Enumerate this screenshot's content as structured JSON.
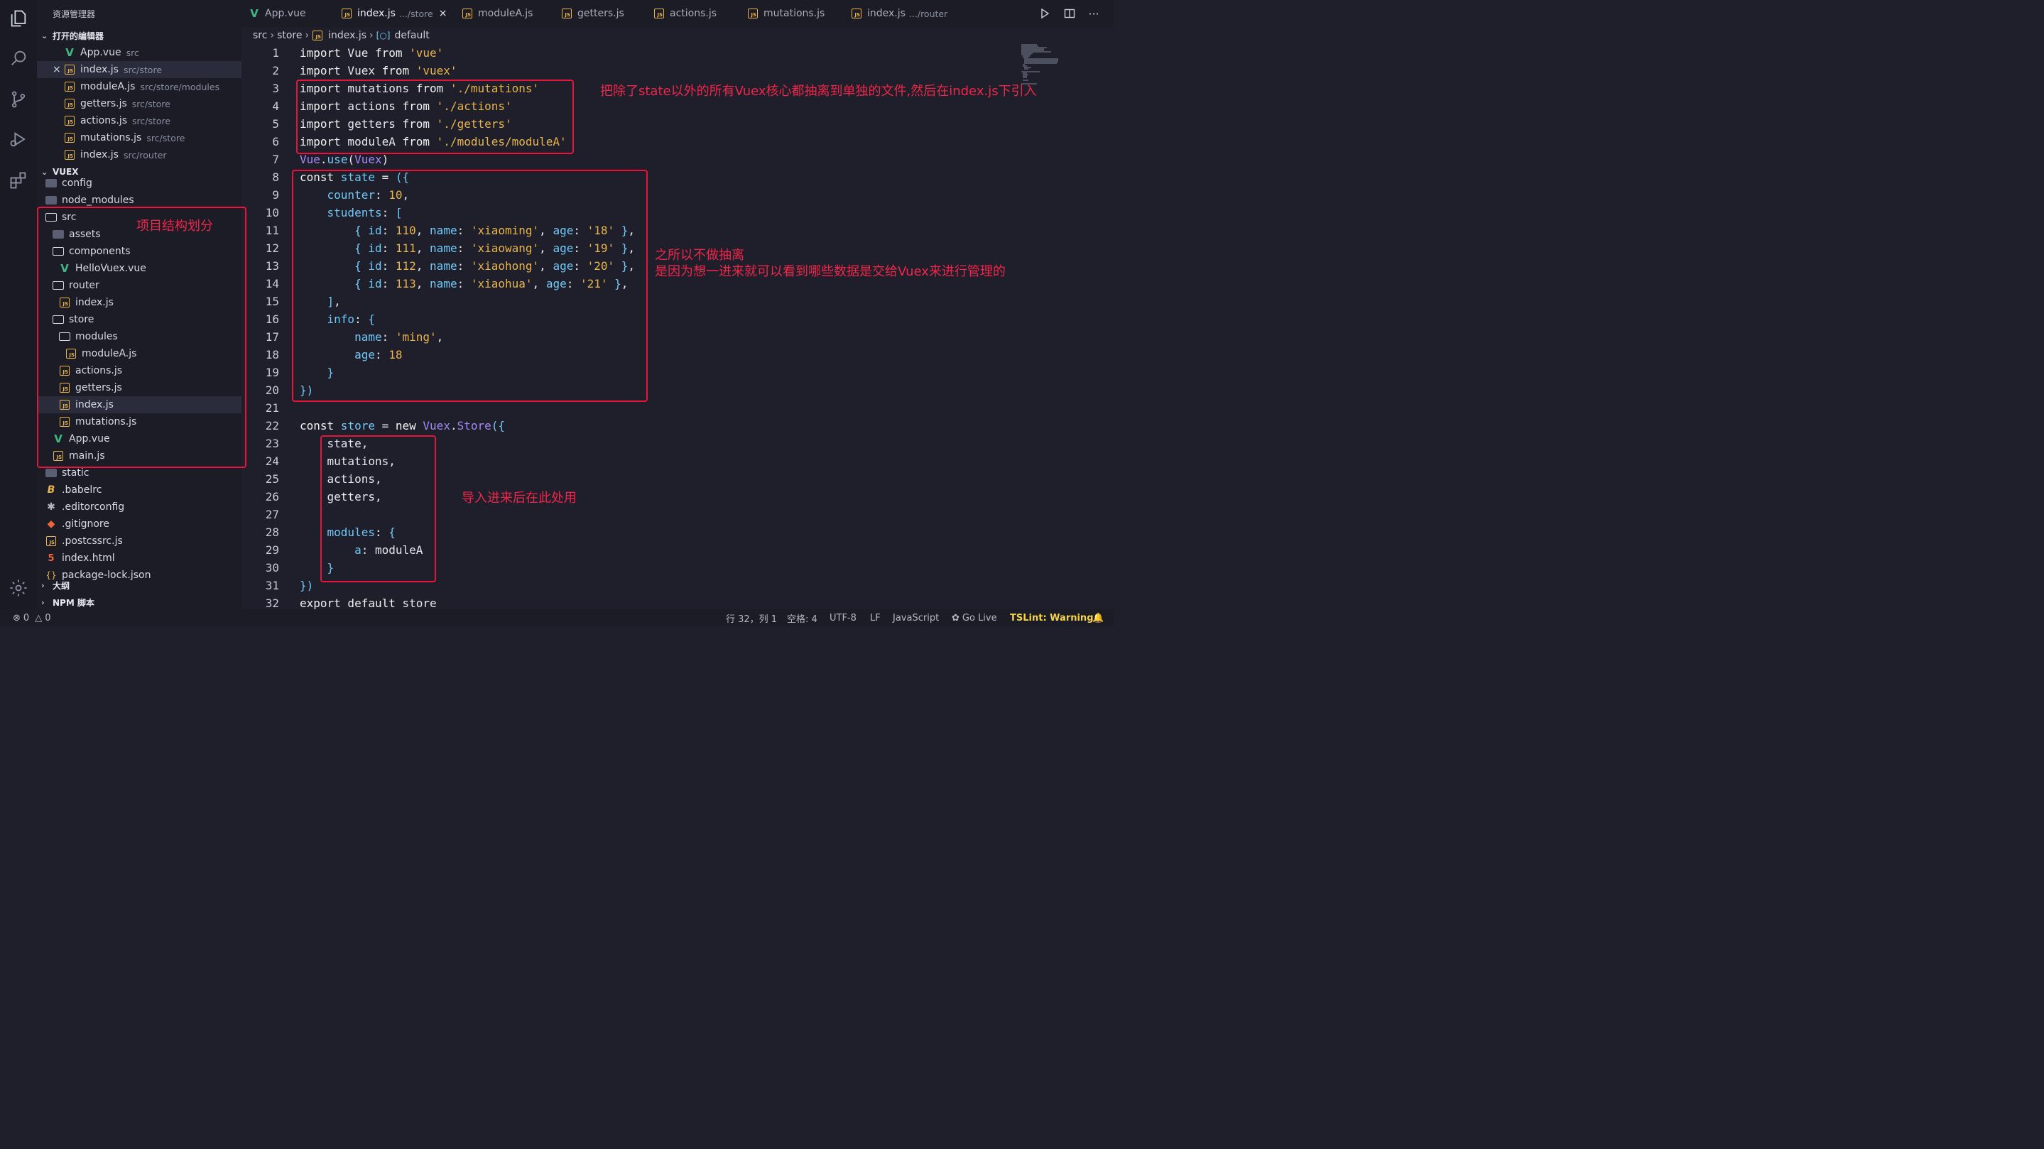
{
  "sidebar": {
    "title": "资源管理器",
    "open_editors_label": "打开的编辑器",
    "open_editors": [
      {
        "name": "App.vue",
        "path": "src",
        "icon": "vue-icon"
      },
      {
        "name": "index.js",
        "path": "src/store",
        "icon": "js-icon",
        "close": "×"
      },
      {
        "name": "moduleA.js",
        "path": "src/store/modules",
        "icon": "js-icon"
      },
      {
        "name": "getters.js",
        "path": "src/store",
        "icon": "js-icon"
      },
      {
        "name": "actions.js",
        "path": "src/store",
        "icon": "js-icon"
      },
      {
        "name": "mutations.js",
        "path": "src/store",
        "icon": "js-icon"
      },
      {
        "name": "index.js",
        "path": "src/router",
        "icon": "js-icon"
      }
    ],
    "project_label": "VUEX",
    "tree": [
      {
        "name": "config",
        "icon": "folder-icon"
      },
      {
        "name": "node_modules",
        "icon": "folder-icon"
      },
      {
        "name": "src",
        "icon": "folder-open-icon"
      },
      {
        "name": "assets",
        "icon": "folder-icon"
      },
      {
        "name": "components",
        "icon": "folder-open-icon"
      },
      {
        "name": "HelloVuex.vue",
        "icon": "vue-icon"
      },
      {
        "name": "router",
        "icon": "folder-open-icon"
      },
      {
        "name": "index.js",
        "icon": "js-icon"
      },
      {
        "name": "store",
        "icon": "folder-open-icon"
      },
      {
        "name": "modules",
        "icon": "folder-open-icon"
      },
      {
        "name": "moduleA.js",
        "icon": "js-icon"
      },
      {
        "name": "actions.js",
        "icon": "js-icon"
      },
      {
        "name": "getters.js",
        "icon": "js-icon"
      },
      {
        "name": "index.js",
        "icon": "js-icon"
      },
      {
        "name": "mutations.js",
        "icon": "js-icon"
      },
      {
        "name": "App.vue",
        "icon": "vue-icon"
      },
      {
        "name": "main.js",
        "icon": "js-icon"
      },
      {
        "name": "static",
        "icon": "folder-icon"
      },
      {
        "name": ".babelrc",
        "icon": "babel-icon"
      },
      {
        "name": ".editorconfig",
        "icon": "gear-small-icon"
      },
      {
        "name": ".gitignore",
        "icon": "git-icon"
      },
      {
        "name": ".postcssrc.js",
        "icon": "js-icon"
      },
      {
        "name": "index.html",
        "icon": "html-icon"
      },
      {
        "name": "package-lock.json",
        "icon": "json-icon"
      }
    ],
    "outline_label": "大纲",
    "npm_label": "NPM 脚本"
  },
  "tabs": [
    {
      "name": "App.vue",
      "desc": "",
      "icon": "vue-icon"
    },
    {
      "name": "index.js",
      "desc": ".../store",
      "icon": "js-icon",
      "close": "×"
    },
    {
      "name": "moduleA.js",
      "desc": "",
      "icon": "js-icon"
    },
    {
      "name": "getters.js",
      "desc": "",
      "icon": "js-icon"
    },
    {
      "name": "actions.js",
      "desc": "",
      "icon": "js-icon"
    },
    {
      "name": "mutations.js",
      "desc": "",
      "icon": "js-icon"
    },
    {
      "name": "index.js",
      "desc": ".../router",
      "icon": "js-icon"
    }
  ],
  "breadcrumb": [
    "src",
    "store",
    "index.js",
    "default"
  ],
  "annotations": {
    "structure": "项目结构划分",
    "extract": "把除了state以外的所有Vuex核心都抽离到单独的文件,然后在index.js下引入",
    "no_extract_1": "之所以不做抽离",
    "no_extract_2": "是因为想一进来就可以看到哪些数据是交给Vuex来进行管理的",
    "use_here": "导入进来后在此处用"
  },
  "line_numbers": [
    "1",
    "2",
    "3",
    "4",
    "5",
    "6",
    "7",
    "8",
    "9",
    "10",
    "11",
    "12",
    "13",
    "14",
    "15",
    "16",
    "17",
    "18",
    "19",
    "20",
    "21",
    "22",
    "23",
    "24",
    "25",
    "26",
    "27",
    "28",
    "29",
    "30",
    "31",
    "32"
  ],
  "code": [
    [
      [
        "kw",
        "import"
      ],
      [
        "ident",
        " Vue "
      ],
      [
        "kw",
        "from"
      ],
      [
        "str",
        " 'vue'"
      ]
    ],
    [
      [
        "kw",
        "import"
      ],
      [
        "ident",
        " Vuex "
      ],
      [
        "kw",
        "from"
      ],
      [
        "str",
        " 'vuex'"
      ]
    ],
    [
      [
        "kw",
        "import"
      ],
      [
        "ident",
        " mutations "
      ],
      [
        "kw",
        "from"
      ],
      [
        "str",
        " './mutations'"
      ]
    ],
    [
      [
        "kw",
        "import"
      ],
      [
        "ident",
        " actions "
      ],
      [
        "kw",
        "from"
      ],
      [
        "str",
        " './actions'"
      ]
    ],
    [
      [
        "kw",
        "import"
      ],
      [
        "ident",
        " getters "
      ],
      [
        "kw",
        "from"
      ],
      [
        "str",
        " './getters'"
      ]
    ],
    [
      [
        "kw",
        "import"
      ],
      [
        "ident",
        " moduleA "
      ],
      [
        "kw",
        "from"
      ],
      [
        "str",
        " './modules/moduleA'"
      ]
    ],
    [
      [
        "fn",
        "Vue"
      ],
      [
        "pun",
        "."
      ],
      [
        "prop",
        "use"
      ],
      [
        "pun",
        "("
      ],
      [
        "fn",
        "Vuex"
      ],
      [
        "pun",
        ")"
      ]
    ],
    [
      [
        "kw",
        "const"
      ],
      [
        "prop",
        " state"
      ],
      [
        "pun",
        " = "
      ],
      [
        "br",
        "({"
      ]
    ],
    [
      [
        "ident",
        "    "
      ],
      [
        "prop",
        "counter"
      ],
      [
        "pun",
        ": "
      ],
      [
        "num",
        "10"
      ],
      [
        "pun",
        ","
      ]
    ],
    [
      [
        "ident",
        "    "
      ],
      [
        "prop",
        "students"
      ],
      [
        "pun",
        ": "
      ],
      [
        "br",
        "["
      ]
    ],
    [
      [
        "ident",
        "        "
      ],
      [
        "br",
        "{"
      ],
      [
        "prop",
        " id"
      ],
      [
        "pun",
        ": "
      ],
      [
        "num",
        "110"
      ],
      [
        "pun",
        ", "
      ],
      [
        "prop",
        "name"
      ],
      [
        "pun",
        ": "
      ],
      [
        "str",
        "'xiaoming'"
      ],
      [
        "pun",
        ", "
      ],
      [
        "prop",
        "age"
      ],
      [
        "pun",
        ": "
      ],
      [
        "str",
        "'18'"
      ],
      [
        "br",
        " }"
      ],
      [
        "pun",
        ","
      ]
    ],
    [
      [
        "ident",
        "        "
      ],
      [
        "br",
        "{"
      ],
      [
        "prop",
        " id"
      ],
      [
        "pun",
        ": "
      ],
      [
        "num",
        "111"
      ],
      [
        "pun",
        ", "
      ],
      [
        "prop",
        "name"
      ],
      [
        "pun",
        ": "
      ],
      [
        "str",
        "'xiaowang'"
      ],
      [
        "pun",
        ", "
      ],
      [
        "prop",
        "age"
      ],
      [
        "pun",
        ": "
      ],
      [
        "str",
        "'19'"
      ],
      [
        "br",
        " }"
      ],
      [
        "pun",
        ","
      ]
    ],
    [
      [
        "ident",
        "        "
      ],
      [
        "br",
        "{"
      ],
      [
        "prop",
        " id"
      ],
      [
        "pun",
        ": "
      ],
      [
        "num",
        "112"
      ],
      [
        "pun",
        ", "
      ],
      [
        "prop",
        "name"
      ],
      [
        "pun",
        ": "
      ],
      [
        "str",
        "'xiaohong'"
      ],
      [
        "pun",
        ", "
      ],
      [
        "prop",
        "age"
      ],
      [
        "pun",
        ": "
      ],
      [
        "str",
        "'20'"
      ],
      [
        "br",
        " }"
      ],
      [
        "pun",
        ","
      ]
    ],
    [
      [
        "ident",
        "        "
      ],
      [
        "br",
        "{"
      ],
      [
        "prop",
        " id"
      ],
      [
        "pun",
        ": "
      ],
      [
        "num",
        "113"
      ],
      [
        "pun",
        ", "
      ],
      [
        "prop",
        "name"
      ],
      [
        "pun",
        ": "
      ],
      [
        "str",
        "'xiaohua'"
      ],
      [
        "pun",
        ", "
      ],
      [
        "prop",
        "age"
      ],
      [
        "pun",
        ": "
      ],
      [
        "str",
        "'21'"
      ],
      [
        "br",
        " }"
      ],
      [
        "pun",
        ","
      ]
    ],
    [
      [
        "ident",
        "    "
      ],
      [
        "br",
        "]"
      ],
      [
        "pun",
        ","
      ]
    ],
    [
      [
        "ident",
        "    "
      ],
      [
        "prop",
        "info"
      ],
      [
        "pun",
        ": "
      ],
      [
        "br",
        "{"
      ]
    ],
    [
      [
        "ident",
        "        "
      ],
      [
        "prop",
        "name"
      ],
      [
        "pun",
        ": "
      ],
      [
        "str",
        "'ming'"
      ],
      [
        "pun",
        ","
      ]
    ],
    [
      [
        "ident",
        "        "
      ],
      [
        "prop",
        "age"
      ],
      [
        "pun",
        ": "
      ],
      [
        "num",
        "18"
      ]
    ],
    [
      [
        "ident",
        "    "
      ],
      [
        "br",
        "}"
      ]
    ],
    [
      [
        "br",
        "})"
      ]
    ],
    [],
    [
      [
        "kw",
        "const"
      ],
      [
        "prop",
        " store"
      ],
      [
        "pun",
        " = "
      ],
      [
        "kw",
        "new"
      ],
      [
        "fn",
        " Vuex"
      ],
      [
        "pun",
        "."
      ],
      [
        "fn",
        "Store"
      ],
      [
        "br",
        "({"
      ]
    ],
    [
      [
        "ident",
        "    "
      ],
      [
        "ident",
        "state,"
      ]
    ],
    [
      [
        "ident",
        "    "
      ],
      [
        "ident",
        "mutations,"
      ]
    ],
    [
      [
        "ident",
        "    "
      ],
      [
        "ident",
        "actions,"
      ]
    ],
    [
      [
        "ident",
        "    "
      ],
      [
        "ident",
        "getters,"
      ]
    ],
    [],
    [
      [
        "ident",
        "    "
      ],
      [
        "prop",
        "modules"
      ],
      [
        "pun",
        ": "
      ],
      [
        "br",
        "{"
      ]
    ],
    [
      [
        "ident",
        "        "
      ],
      [
        "prop",
        "a"
      ],
      [
        "pun",
        ": "
      ],
      [
        "ident",
        "moduleA"
      ]
    ],
    [
      [
        "ident",
        "    "
      ],
      [
        "br",
        "}"
      ]
    ],
    [
      [
        "br",
        "})"
      ]
    ],
    [
      [
        "kw",
        "export"
      ],
      [
        "kw",
        " default"
      ],
      [
        "ident",
        " store"
      ]
    ]
  ],
  "status": {
    "errors": "0",
    "warnings": "0",
    "position": "行 32，列 1",
    "spaces": "空格: 4",
    "encoding": "UTF-8",
    "eol": "LF",
    "language": "JavaScript",
    "golive": "Go Live",
    "tslint": "TSLint: Warning"
  },
  "colors": {
    "annotation": "#e8143c",
    "string": "#e9b44c",
    "property": "#71c9f8",
    "function": "#a58af7",
    "vue": "#41b883"
  }
}
